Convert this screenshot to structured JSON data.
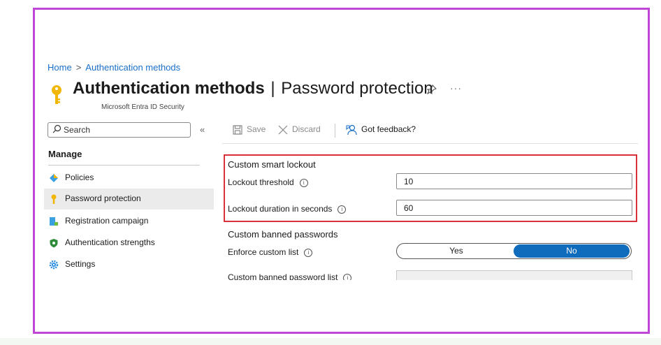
{
  "breadcrumb": {
    "home": "Home",
    "separator": ">",
    "current": "Authentication methods"
  },
  "header": {
    "title_bold": "Authentication methods",
    "title_separator": "|",
    "title_rest": "Password protection",
    "subtitle": "Microsoft Entra ID Security",
    "more_label": "···",
    "pin_icon": "pin-icon",
    "key_color": "#f2b705"
  },
  "sidebar": {
    "search_placeholder": "Search",
    "collapse_label": "«",
    "section_title": "Manage",
    "items": [
      {
        "label": "Policies",
        "icon": "policies-icon"
      },
      {
        "label": "Password protection",
        "icon": "key-icon",
        "selected": true
      },
      {
        "label": "Registration campaign",
        "icon": "registration-icon"
      },
      {
        "label": "Authentication strengths",
        "icon": "shield-icon"
      },
      {
        "label": "Settings",
        "icon": "gear-icon"
      }
    ]
  },
  "toolbar": {
    "save_label": "Save",
    "discard_label": "Discard",
    "feedback_label": "Got feedback?"
  },
  "lockout": {
    "heading": "Custom smart lockout",
    "threshold_label": "Lockout threshold",
    "threshold_value": "10",
    "duration_label": "Lockout duration in seconds",
    "duration_value": "60",
    "info_glyph": "i"
  },
  "banned": {
    "heading": "Custom banned passwords",
    "enforce_label": "Enforce custom list",
    "toggle_yes": "Yes",
    "toggle_no": "No",
    "toggle_selected": "No",
    "list_label": "Custom banned password list"
  },
  "colors": {
    "frame": "#c046d8",
    "highlight": "#d9303a",
    "accent": "#0f6cbd",
    "link": "#1a6fc9"
  }
}
